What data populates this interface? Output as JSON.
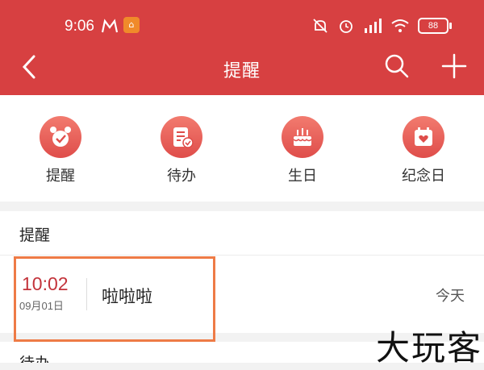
{
  "status_bar": {
    "time": "9:06",
    "app_badge": "",
    "battery": "88"
  },
  "header": {
    "title": "提醒",
    "icons": [
      "back-icon",
      "search-icon",
      "plus-icon"
    ]
  },
  "categories": [
    {
      "label": "提醒",
      "icon": "alarm-clock-icon"
    },
    {
      "label": "待办",
      "icon": "todo-list-icon"
    },
    {
      "label": "生日",
      "icon": "birthday-cake-icon"
    },
    {
      "label": "纪念日",
      "icon": "heart-calendar-icon"
    }
  ],
  "sections": {
    "reminder": {
      "title": "提醒"
    },
    "todo": {
      "title": "待办"
    }
  },
  "reminders": [
    {
      "time": "10:02",
      "date": "09月01日",
      "title": "啦啦啦",
      "day": "今天"
    }
  ],
  "watermark": "大玩客",
  "colors": {
    "header_bg": "#d74041",
    "accent": "#c3333a",
    "highlight_border": "#ee7b46"
  }
}
